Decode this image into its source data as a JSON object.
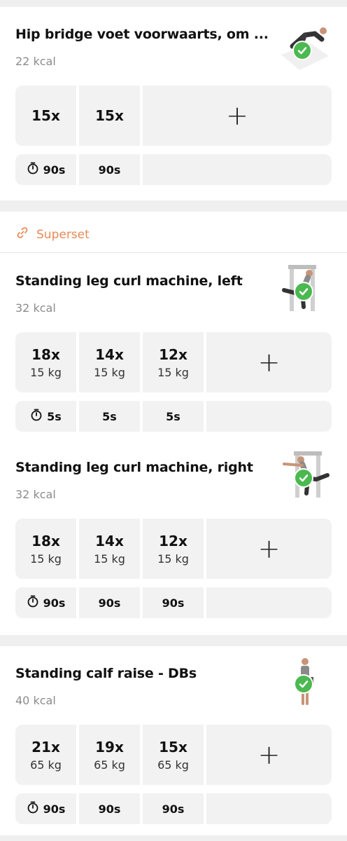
{
  "exercises": [
    {
      "title": "Hip bridge voet voorwaarts, om ...",
      "kcal": "22 kcal",
      "thumb": "hip-bridge-thumbnail",
      "sets": [
        {
          "reps": "15x",
          "weight": ""
        },
        {
          "reps": "15x",
          "weight": ""
        }
      ],
      "rests": [
        "90s",
        "90s"
      ]
    },
    {
      "title": "Standing leg curl machine, left",
      "kcal": "32 kcal",
      "thumb": "leg-curl-left-thumbnail",
      "sets": [
        {
          "reps": "18x",
          "weight": "15 kg"
        },
        {
          "reps": "14x",
          "weight": "15 kg"
        },
        {
          "reps": "12x",
          "weight": "15 kg"
        }
      ],
      "rests": [
        "5s",
        "5s",
        "5s"
      ]
    },
    {
      "title": "Standing leg curl machine, right",
      "kcal": "32 kcal",
      "thumb": "leg-curl-right-thumbnail",
      "sets": [
        {
          "reps": "18x",
          "weight": "15 kg"
        },
        {
          "reps": "14x",
          "weight": "15 kg"
        },
        {
          "reps": "12x",
          "weight": "15 kg"
        }
      ],
      "rests": [
        "90s",
        "90s",
        "90s"
      ]
    },
    {
      "title": "Standing calf raise - DBs",
      "kcal": "40 kcal",
      "thumb": "calf-raise-thumbnail",
      "sets": [
        {
          "reps": "21x",
          "weight": "65 kg"
        },
        {
          "reps": "19x",
          "weight": "65 kg"
        },
        {
          "reps": "15x",
          "weight": "65 kg"
        }
      ],
      "rests": [
        "90s",
        "90s",
        "90s"
      ]
    }
  ],
  "superset_label": "Superset",
  "add_symbol": "+",
  "colors": {
    "accent": "#e98a55",
    "check": "#4bb94f",
    "cell": "#f2f2f2",
    "background": "#efefef"
  },
  "icons": {
    "rest": "stopwatch-icon",
    "superset": "link-icon",
    "done": "checkmark-icon",
    "add": "plus-icon"
  }
}
